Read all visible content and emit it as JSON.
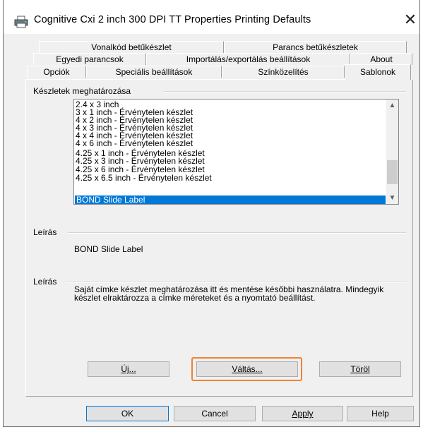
{
  "window": {
    "title": "Cognitive Cxi 2 inch 300 DPI TT Properties Printing Defaults",
    "close_glyph": "✕"
  },
  "tabs": {
    "row1": [
      "Vonalkód betűkészlet",
      "Parancs betűkészletek"
    ],
    "row2": [
      "Egyedi parancsok",
      "Importálás/exportálás beállítások",
      "About"
    ],
    "row3": [
      "Opciók",
      "Speciális beállítások",
      "Színközelítés",
      "Sablonok"
    ],
    "active": "Sablonok"
  },
  "sets_group": {
    "label": "Készletek meghatározása",
    "items": [
      "2.4 x 3 inch",
      "3 x 1 inch - Érvénytelen készlet",
      "4 x 2 inch - Érvénytelen készlet",
      "4 x 3 inch - Érvénytelen készlet",
      "4 x 4 inch - Érvénytelen készlet",
      "4 x 6 inch - Érvénytelen készlet",
      "4.25 x 1 inch - Érvénytelen készlet",
      "4.25 x 3 inch - Érvénytelen készlet",
      "4.25 x 6 inch - Érvénytelen készlet",
      "4.25 x 6.5 inch - Érvénytelen készlet",
      "BOND Slide Label"
    ],
    "selected": "BOND Slide Label"
  },
  "description1": {
    "label": "Leírás",
    "text": "BOND Slide Label"
  },
  "description2": {
    "label": "Leírás",
    "text": "Saját címke készlet meghatározása itt és mentése későbbi használatra. Mindegyik készlet elraktározza a címke méreteket és a nyomtató beállítást."
  },
  "actions": {
    "new_label": "Új...",
    "change_label": "Váltás...",
    "delete_label": "Töröl"
  },
  "footer": {
    "ok": "OK",
    "cancel": "Cancel",
    "apply": "Apply",
    "help": "Help"
  },
  "colors": {
    "selection": "#0078d7",
    "highlight": "#f08232",
    "dialog_bg": "#f0f0f0"
  }
}
